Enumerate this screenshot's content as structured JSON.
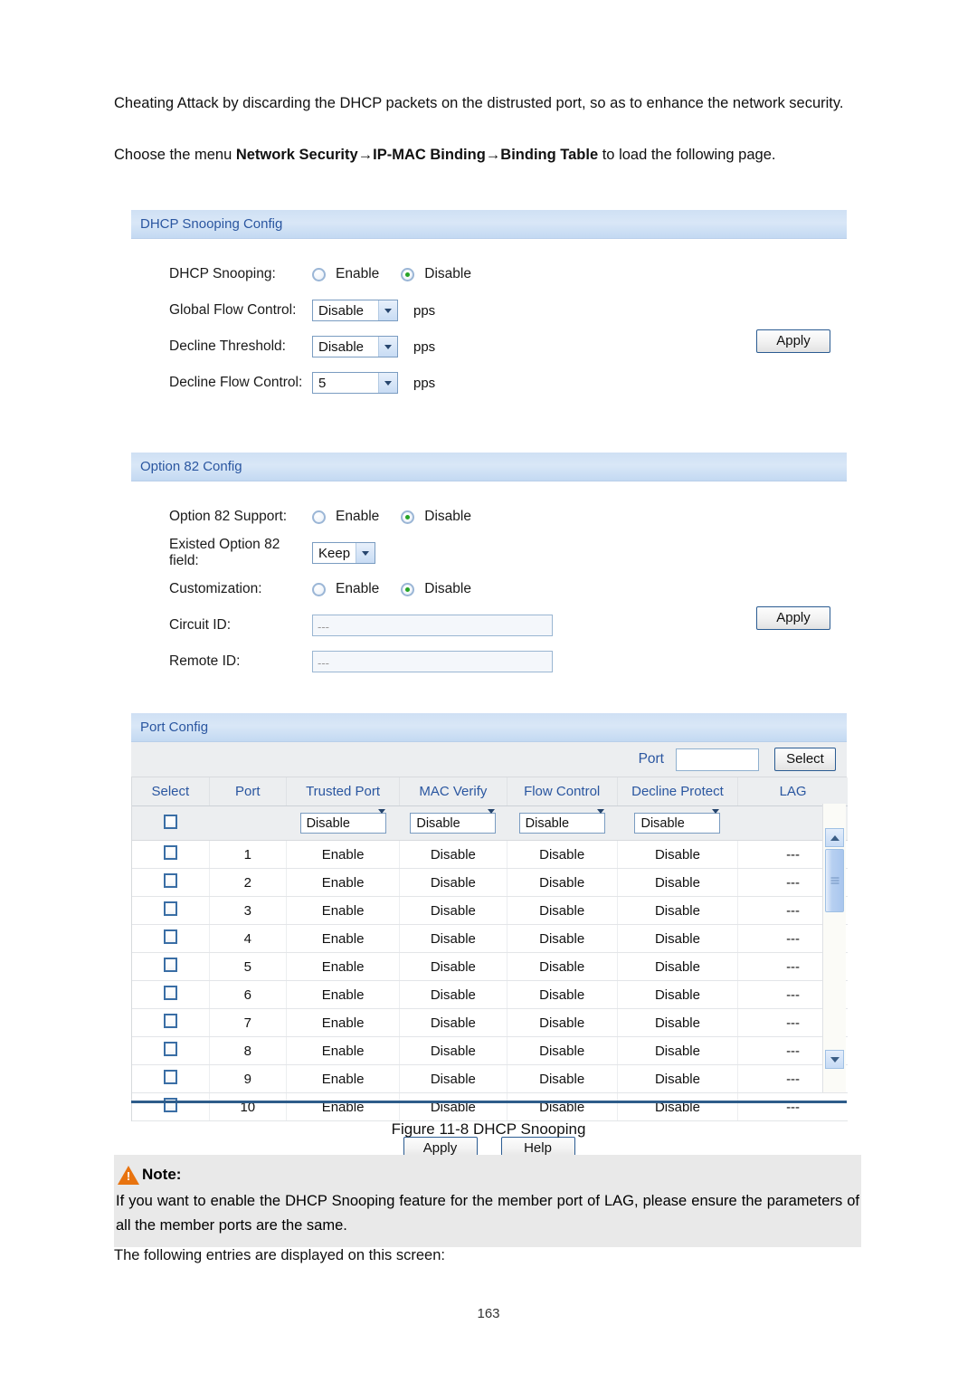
{
  "document": {
    "intro_paragraph_1": "Cheating Attack by discarding the DHCP packets on the distrusted port, so as to enhance the network security.",
    "intro_choose_prefix": "Choose the menu ",
    "intro_menu_path": "Network Security→IP-MAC Binding→Binding Table",
    "intro_choose_suffix": " to load the following page.",
    "figure_caption": "Figure 11-8 DHCP Snooping",
    "note_label": "Note:",
    "note_body": "If you want to enable the DHCP Snooping feature for the member port of LAG, please ensure the parameters of all the member ports are the same.",
    "after_note": "The following entries are displayed on this screen:",
    "page_number": "163"
  },
  "dhcp_snooping_config": {
    "title": "DHCP Snooping Config",
    "rows": {
      "dhcp_snooping": {
        "label": "DHCP Snooping:",
        "enable_label": "Enable",
        "disable_label": "Disable",
        "selected": "Disable"
      },
      "global_flow_control": {
        "label": "Global Flow Control:",
        "value": "Disable",
        "unit": "pps"
      },
      "decline_threshold": {
        "label": "Decline Threshold:",
        "value": "Disable",
        "unit": "pps"
      },
      "decline_flow_control": {
        "label": "Decline Flow Control:",
        "value": "5",
        "unit": "pps"
      }
    },
    "apply_label": "Apply"
  },
  "option82_config": {
    "title": "Option 82 Config",
    "rows": {
      "option82_support": {
        "label": "Option 82 Support:",
        "enable_label": "Enable",
        "disable_label": "Disable",
        "selected": "Disable"
      },
      "existed_option82_field": {
        "label": "Existed Option 82 field:",
        "value": "Keep"
      },
      "customization": {
        "label": "Customization:",
        "enable_label": "Enable",
        "disable_label": "Disable",
        "selected": "Disable"
      },
      "circuit_id": {
        "label": "Circuit ID:",
        "value": "---"
      },
      "remote_id": {
        "label": "Remote ID:",
        "value": "---"
      }
    },
    "apply_label": "Apply"
  },
  "port_config": {
    "title": "Port Config",
    "search": {
      "port_label": "Port",
      "port_value": "",
      "select_button": "Select"
    },
    "columns": [
      "Select",
      "Port",
      "Trusted Port",
      "MAC Verify",
      "Flow Control",
      "Decline Protect",
      "LAG"
    ],
    "bulk_row": {
      "trusted_port": "Disable",
      "mac_verify": "Disable",
      "flow_control": "Disable",
      "decline_protect": "Disable"
    },
    "rows": [
      {
        "port": "1",
        "trusted_port": "Enable",
        "mac_verify": "Disable",
        "flow_control": "Disable",
        "decline_protect": "Disable",
        "lag": "---"
      },
      {
        "port": "2",
        "trusted_port": "Enable",
        "mac_verify": "Disable",
        "flow_control": "Disable",
        "decline_protect": "Disable",
        "lag": "---"
      },
      {
        "port": "3",
        "trusted_port": "Enable",
        "mac_verify": "Disable",
        "flow_control": "Disable",
        "decline_protect": "Disable",
        "lag": "---"
      },
      {
        "port": "4",
        "trusted_port": "Enable",
        "mac_verify": "Disable",
        "flow_control": "Disable",
        "decline_protect": "Disable",
        "lag": "---"
      },
      {
        "port": "5",
        "trusted_port": "Enable",
        "mac_verify": "Disable",
        "flow_control": "Disable",
        "decline_protect": "Disable",
        "lag": "---"
      },
      {
        "port": "6",
        "trusted_port": "Enable",
        "mac_verify": "Disable",
        "flow_control": "Disable",
        "decline_protect": "Disable",
        "lag": "---"
      },
      {
        "port": "7",
        "trusted_port": "Enable",
        "mac_verify": "Disable",
        "flow_control": "Disable",
        "decline_protect": "Disable",
        "lag": "---"
      },
      {
        "port": "8",
        "trusted_port": "Enable",
        "mac_verify": "Disable",
        "flow_control": "Disable",
        "decline_protect": "Disable",
        "lag": "---"
      },
      {
        "port": "9",
        "trusted_port": "Enable",
        "mac_verify": "Disable",
        "flow_control": "Disable",
        "decline_protect": "Disable",
        "lag": "---"
      },
      {
        "port": "10",
        "trusted_port": "Enable",
        "mac_verify": "Disable",
        "flow_control": "Disable",
        "decline_protect": "Disable",
        "lag": "---"
      }
    ],
    "apply_label": "Apply",
    "help_label": "Help"
  },
  "colors": {
    "section_header_text": "#2a56a0",
    "table_header_text": "#2a56a0",
    "radio_selected_dot": "#27a427",
    "divider": "#2e5c8a",
    "note_icon": "#e8730f",
    "note_background": "#e9e9e9"
  }
}
